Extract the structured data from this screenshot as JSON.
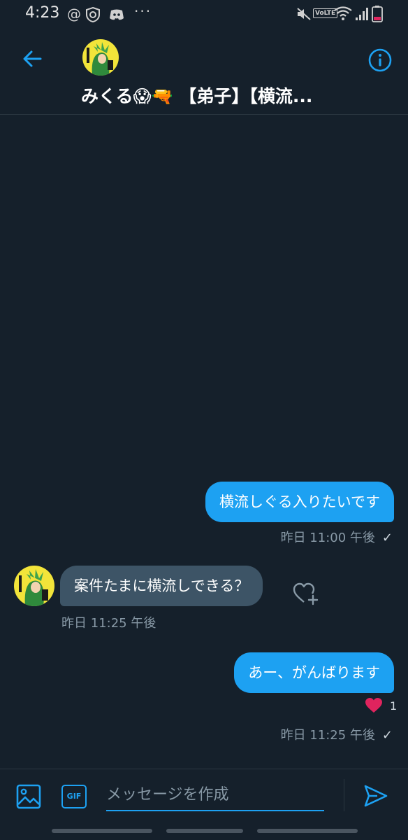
{
  "status_bar": {
    "time": "4:23",
    "at_symbol": "@",
    "more_dots": "···",
    "volte": "VoLTE"
  },
  "header": {
    "title": "みくる😱🔫 【弟子】【横流..."
  },
  "messages": [
    {
      "direction": "sent",
      "text": "横流しぐる入りたいです",
      "meta": "昨日 11:00 午後",
      "status": "✓"
    },
    {
      "direction": "received",
      "text": "案件たまに横流しできる？",
      "meta": "昨日 11:25 午後"
    },
    {
      "direction": "sent",
      "text": "あー、がんばります",
      "reaction_count": "1",
      "meta": "昨日 11:25 午後",
      "status": "✓"
    }
  ],
  "composer": {
    "gif_label": "GIF",
    "placeholder": "メッセージを作成"
  },
  "colors": {
    "background": "#15202b",
    "accent": "#1da1f2",
    "received_bubble": "#3d5466",
    "muted_text": "#8899a6",
    "heart": "#e0245e"
  },
  "icons": [
    "back-arrow-icon",
    "info-icon",
    "heart-plus-icon",
    "heart-icon",
    "image-icon",
    "send-icon"
  ]
}
